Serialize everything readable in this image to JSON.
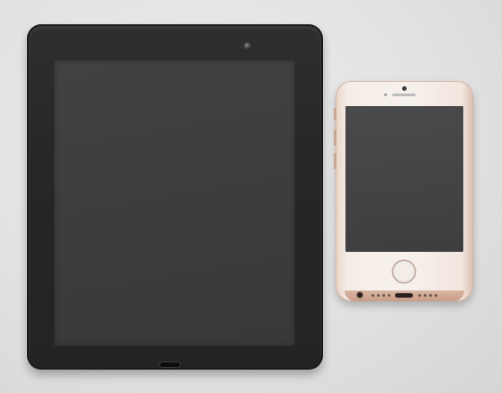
{
  "scene": {
    "background_color": "#e3e3e3",
    "objects": [
      {
        "name": "tablet",
        "color": "#262626",
        "screen_color": "#3f3f41"
      },
      {
        "name": "smartphone",
        "color": "#f5ebe5",
        "trim_color": "#d2ab98",
        "screen_color": "#444446"
      }
    ]
  }
}
